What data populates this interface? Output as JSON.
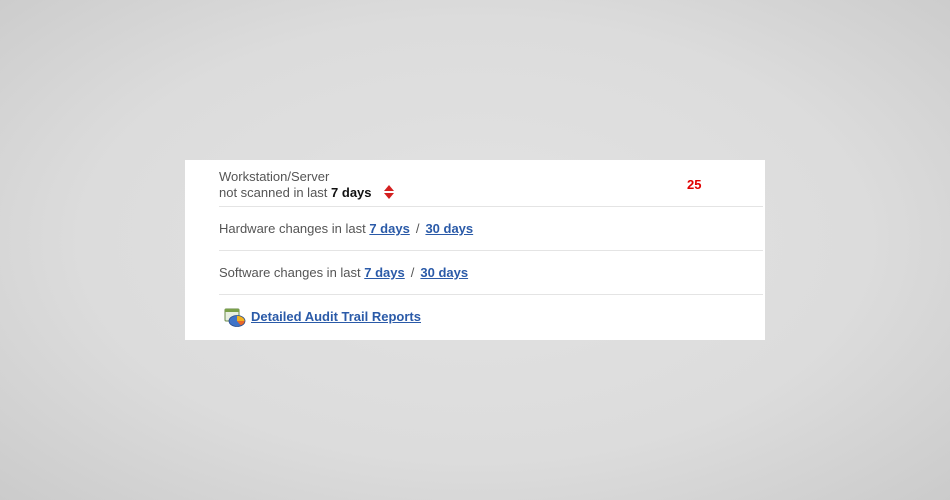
{
  "widget": {
    "row1": {
      "line1": "Workstation/Server",
      "line2_prefix": "not scanned in last",
      "line2_strong": "7 days",
      "count": "25",
      "sort_icon": "sort-up-down-icon"
    },
    "row2": {
      "prefix": "Hardware changes in last",
      "link1": "7 days",
      "separator": "/",
      "link2": "30 days"
    },
    "row3": {
      "prefix": "Software changes in last",
      "link1": "7 days",
      "separator": "/",
      "link2": "30 days"
    },
    "row4": {
      "icon": "report-chart-icon",
      "link": "Detailed Audit Trail Reports"
    }
  },
  "colors": {
    "link": "#2a5aa8",
    "count": "#e00000",
    "sort_icon": "#d42020",
    "text": "#555555"
  }
}
